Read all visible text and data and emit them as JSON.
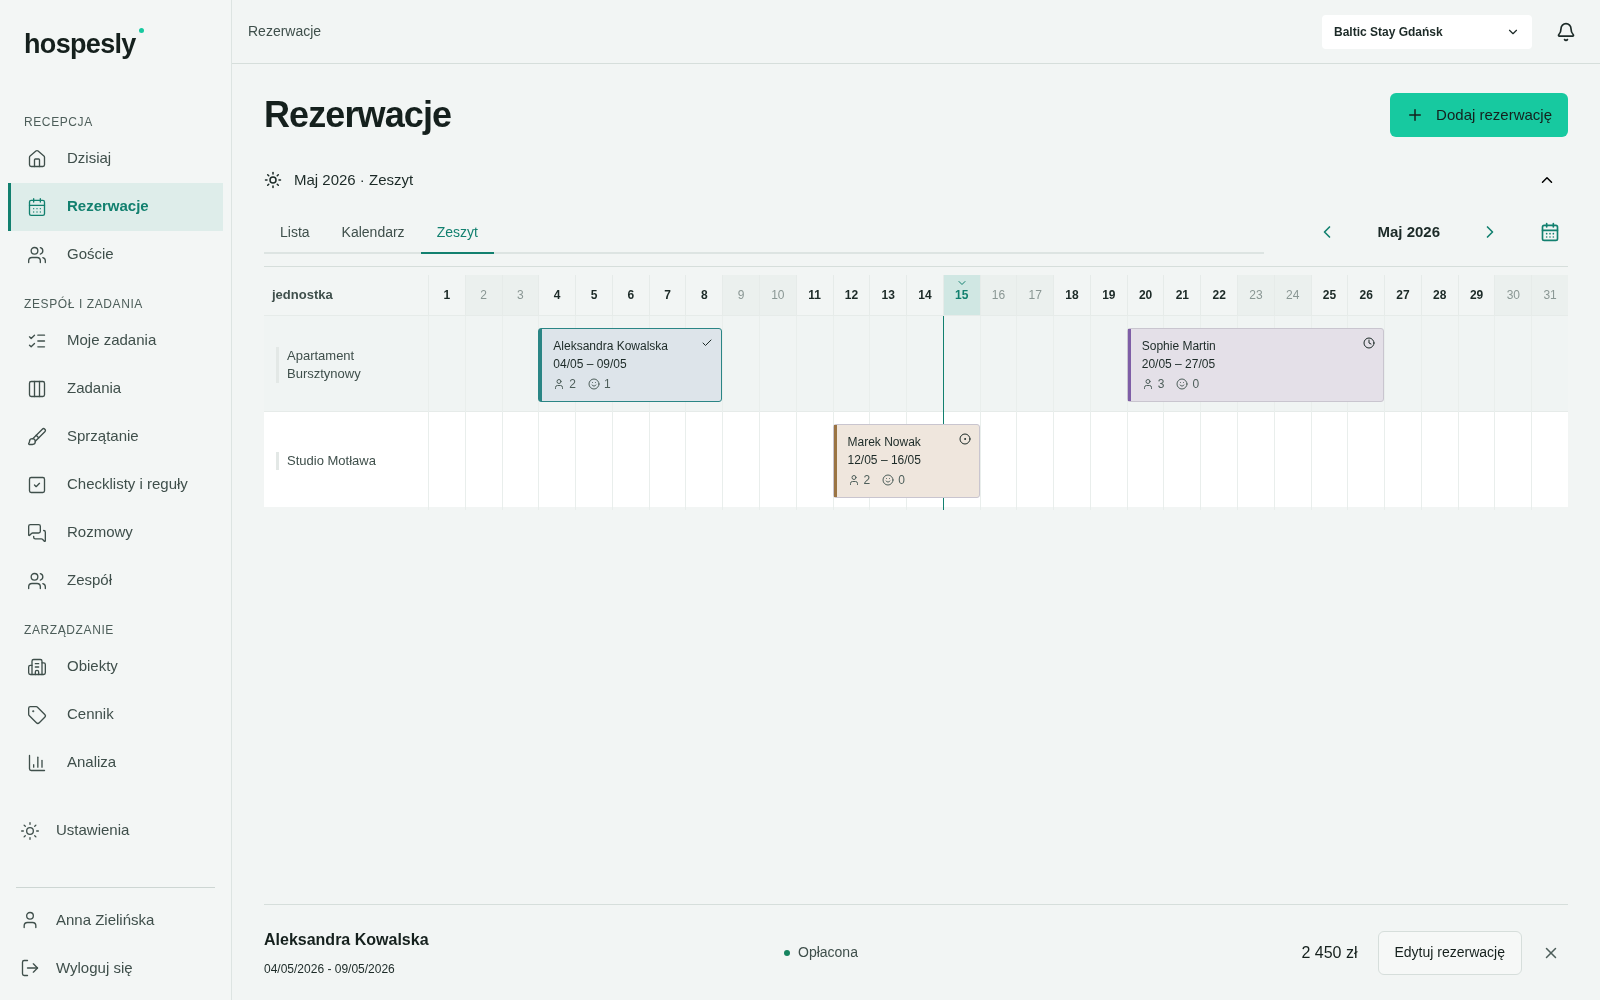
{
  "brand": {
    "name": "hospesly"
  },
  "sidebar": {
    "sections": [
      {
        "title": "RECEPCJA",
        "items": [
          {
            "label": "Dzisiaj",
            "selected": false
          },
          {
            "label": "Rezerwacje",
            "selected": true
          },
          {
            "label": "Goście",
            "selected": false
          }
        ]
      },
      {
        "title": "ZESPÓŁ I ZADANIA",
        "items": [
          {
            "label": "Moje zadania",
            "selected": false
          },
          {
            "label": "Zadania",
            "selected": false
          },
          {
            "label": "Sprzątanie",
            "selected": false
          },
          {
            "label": "Checklisty i reguły",
            "selected": false
          },
          {
            "label": "Rozmowy",
            "selected": false
          },
          {
            "label": "Zespół",
            "selected": false
          }
        ]
      },
      {
        "title": "ZARZĄDZANIE",
        "items": [
          {
            "label": "Obiekty",
            "selected": false
          },
          {
            "label": "Cennik",
            "selected": false
          },
          {
            "label": "Analiza",
            "selected": false
          }
        ]
      }
    ],
    "settings": "Ustawienia",
    "user": "Anna Zielińska",
    "logout": "Wyloguj się"
  },
  "header": {
    "breadcrumb": "Rezerwacje",
    "property": "Baltic Stay Gdańsk"
  },
  "page": {
    "title": "Rezerwacje",
    "add_button": "Dodaj rezerwację",
    "view_label": "Maj 2026 · Zeszyt"
  },
  "tabs": [
    {
      "label": "Lista",
      "selected": false
    },
    {
      "label": "Kalendarz",
      "selected": false
    },
    {
      "label": "Zeszyt",
      "selected": true
    }
  ],
  "month": "Maj 2026",
  "grid": {
    "unit_header": "jednostka",
    "days": [
      {
        "label": "1",
        "weekend": false,
        "today": false
      },
      {
        "label": "2",
        "weekend": true,
        "today": false
      },
      {
        "label": "3",
        "weekend": true,
        "today": false
      },
      {
        "label": "4",
        "weekend": false,
        "today": false
      },
      {
        "label": "5",
        "weekend": false,
        "today": false
      },
      {
        "label": "6",
        "weekend": false,
        "today": false
      },
      {
        "label": "7",
        "weekend": false,
        "today": false
      },
      {
        "label": "8",
        "weekend": false,
        "today": false
      },
      {
        "label": "9",
        "weekend": true,
        "today": false
      },
      {
        "label": "10",
        "weekend": true,
        "today": false
      },
      {
        "label": "11",
        "weekend": false,
        "today": false
      },
      {
        "label": "12",
        "weekend": false,
        "today": false
      },
      {
        "label": "13",
        "weekend": false,
        "today": false
      },
      {
        "label": "14",
        "weekend": false,
        "today": false
      },
      {
        "label": "15",
        "weekend": false,
        "today": true
      },
      {
        "label": "16",
        "weekend": true,
        "today": false
      },
      {
        "label": "17",
        "weekend": true,
        "today": false
      },
      {
        "label": "18",
        "weekend": false,
        "today": false
      },
      {
        "label": "19",
        "weekend": false,
        "today": false
      },
      {
        "label": "20",
        "weekend": false,
        "today": false
      },
      {
        "label": "21",
        "weekend": false,
        "today": false
      },
      {
        "label": "22",
        "weekend": false,
        "today": false
      },
      {
        "label": "23",
        "weekend": true,
        "today": false
      },
      {
        "label": "24",
        "weekend": true,
        "today": false
      },
      {
        "label": "25",
        "weekend": false,
        "today": false
      },
      {
        "label": "26",
        "weekend": false,
        "today": false
      },
      {
        "label": "27",
        "weekend": false,
        "today": false
      },
      {
        "label": "28",
        "weekend": false,
        "today": false
      },
      {
        "label": "29",
        "weekend": false,
        "today": false
      },
      {
        "label": "30",
        "weekend": true,
        "today": false
      },
      {
        "label": "31",
        "weekend": true,
        "today": false
      }
    ],
    "units": [
      {
        "name": "Apartament Bursztynowy",
        "selected": true,
        "bookings": [
          {
            "guest": "Aleksandra Kowalska",
            "dates": "04/05 – 09/05",
            "adults": "2",
            "kids": "1",
            "kind": "confirmed",
            "color": "#2a8585",
            "selected": true
          },
          {
            "guest": "Sophie Martin",
            "dates": "20/05 – 27/05",
            "adults": "3",
            "kids": "0",
            "kind": "pending",
            "color": "#7e5ea6",
            "selected": false
          }
        ]
      },
      {
        "name": "Studio Motława",
        "selected": false,
        "bookings": [
          {
            "guest": "Marek Nowak",
            "dates": "12/05 – 16/05",
            "adults": "2",
            "kids": "0",
            "kind": "partial",
            "color": "#9a7443",
            "selected": false
          }
        ]
      }
    ]
  },
  "details": {
    "guest": "Aleksandra Kowalska",
    "dates": "04/05/2026 - 09/05/2026",
    "status": {
      "label": "Opłacona",
      "color": "#17845f"
    },
    "amount": "2 450 zł",
    "edit_button": "Edytuj rezerwację"
  }
}
